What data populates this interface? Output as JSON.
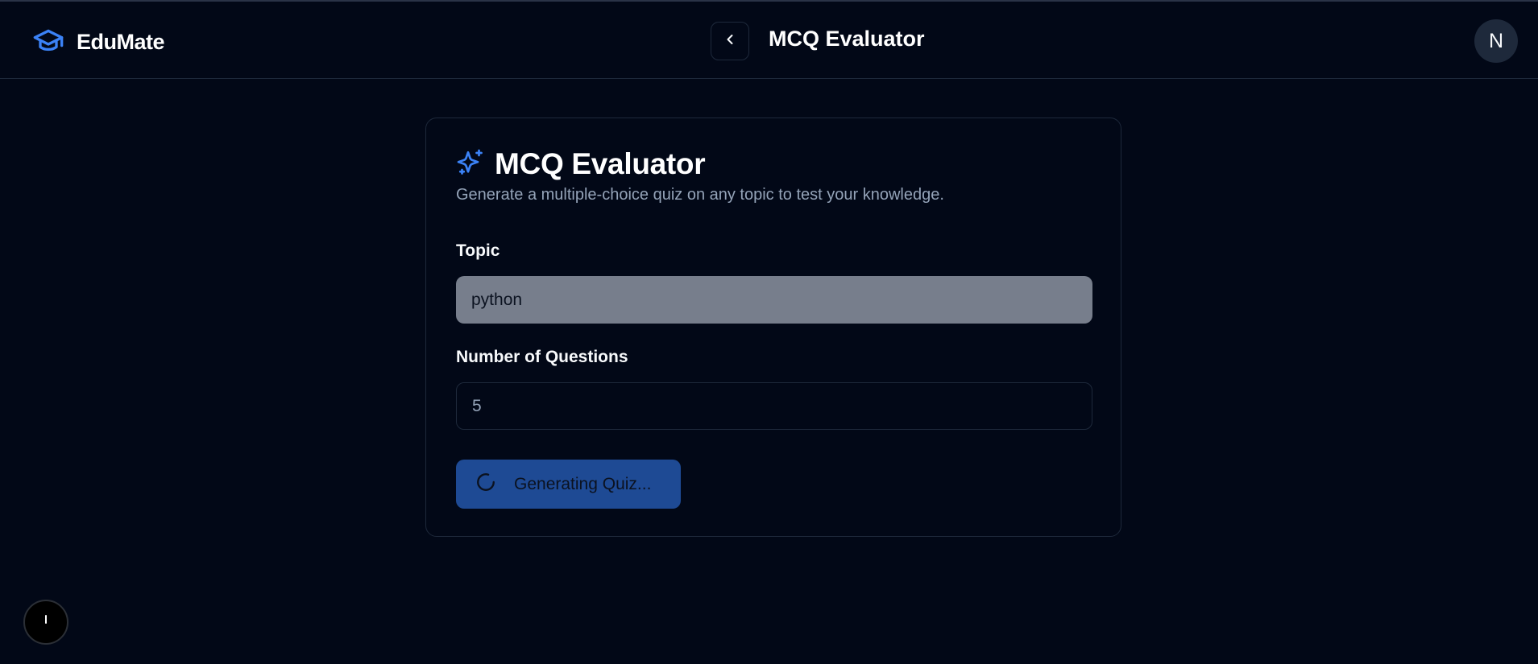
{
  "header": {
    "brand": "EduMate",
    "title": "MCQ Evaluator",
    "avatar_initial": "N"
  },
  "card": {
    "title": "MCQ Evaluator",
    "subtitle": "Generate a multiple-choice quiz on any topic to test your knowledge.",
    "topic_label": "Topic",
    "topic_value": "python",
    "questions_label": "Number of Questions",
    "questions_value": "5",
    "generate_button_label": "Generating Quiz..."
  },
  "icons": {
    "brand": "graduation-cap-icon",
    "back": "chevron-left-icon",
    "title": "sparkles-icon",
    "loading": "spinner-icon",
    "floating": "exclamation-icon"
  },
  "colors": {
    "background": "#020817",
    "accent": "#3b82f6",
    "button": "#1e4a94",
    "muted_text": "#94a3b8"
  }
}
